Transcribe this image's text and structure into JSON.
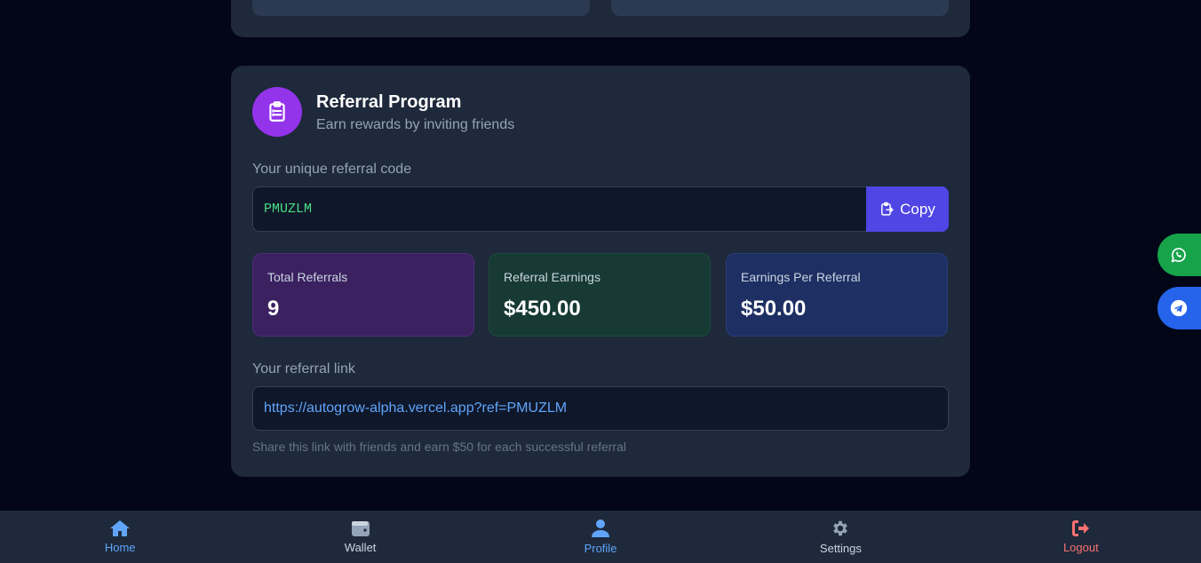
{
  "referral": {
    "title": "Referral Program",
    "subtitle": "Earn rewards by inviting friends",
    "icon": "clipboard-list-icon",
    "code_label": "Your unique referral code",
    "code": "PMUZLM",
    "copy_label": "Copy",
    "stats": [
      {
        "label": "Total Referrals",
        "value": "9"
      },
      {
        "label": "Referral Earnings",
        "value": "$450.00"
      },
      {
        "label": "Earnings Per Referral",
        "value": "$50.00"
      }
    ],
    "link_label": "Your referral link",
    "link": "https://autogrow-alpha.vercel.app?ref=PMUZLM",
    "hint": "Share this link with friends and earn $50 for each successful referral"
  },
  "floating": {
    "whatsapp_icon": "whatsapp-icon",
    "telegram_icon": "telegram-icon"
  },
  "nav": {
    "items": [
      {
        "label": "Home",
        "icon": "home-icon",
        "color": "#60a5fa"
      },
      {
        "label": "Wallet",
        "icon": "wallet-icon",
        "color": "#cbd5e1"
      },
      {
        "label": "Profile",
        "icon": "user-icon",
        "color": "#60a5fa"
      },
      {
        "label": "Settings",
        "icon": "gear-icon",
        "color": "#cbd5e1"
      },
      {
        "label": "Logout",
        "icon": "logout-icon",
        "color": "#f87171"
      }
    ]
  },
  "colors": {
    "background": "#020617",
    "card": "#1e293b",
    "accent_purple": "#9333ea",
    "copy_button": "#4f46e5",
    "code_text": "#4ade80",
    "link_text": "#60a5fa",
    "whatsapp": "#16a34a",
    "telegram": "#2563eb"
  }
}
